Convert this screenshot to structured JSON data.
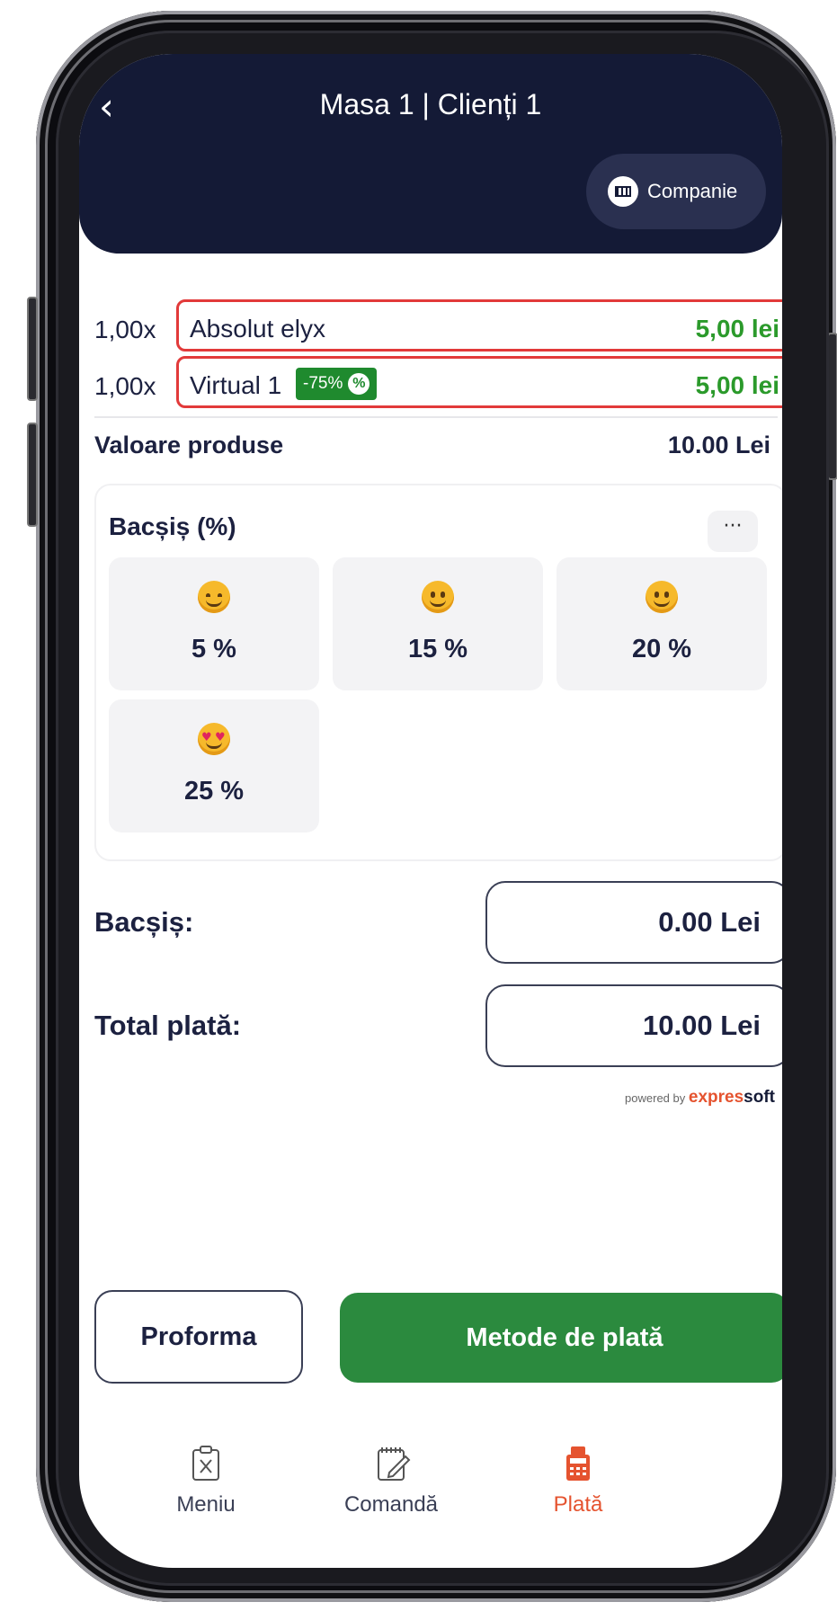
{
  "header": {
    "title": "Masa 1 | Clienți 1",
    "company_label": "Companie"
  },
  "products": [
    {
      "qty": "1,00x",
      "name": "Absolut elyx",
      "price": "5,00 lei"
    },
    {
      "qty": "1,00x",
      "name": "Virtual 1",
      "discount": "-75%",
      "price": "5,00 lei"
    }
  ],
  "summary": {
    "value_label": "Valoare produse",
    "value_amount": "10.00 Lei"
  },
  "tip": {
    "title": "Bacșiș (%)",
    "more": "···",
    "options": [
      {
        "label": "5 %",
        "emoji": "smiling-face-icon"
      },
      {
        "label": "15 %",
        "emoji": "grinning-face-icon"
      },
      {
        "label": "20 %",
        "emoji": "grinning-face-icon"
      },
      {
        "label": "25 %",
        "emoji": "heart-eyes-face-icon"
      }
    ]
  },
  "totals": {
    "tip_label": "Bacșiș:",
    "tip_value": "0.00 Lei",
    "total_label": "Total plată:",
    "total_value": "10.00 Lei"
  },
  "branding": {
    "powered_by": "powered by",
    "brand_a": "expres",
    "brand_b": "soft"
  },
  "actions": {
    "proforma": "Proforma",
    "pay_methods": "Metode de plată"
  },
  "nav": [
    {
      "label": "Meniu",
      "icon": "menu-clipboard-icon",
      "active": false
    },
    {
      "label": "Comandă",
      "icon": "order-notepad-icon",
      "active": false
    },
    {
      "label": "Plată",
      "icon": "payment-terminal-icon",
      "active": true
    }
  ],
  "colors": {
    "header_bg": "#141a36",
    "accent_green": "#2b8a3e",
    "price_green": "#2b9a2b",
    "highlight_red": "#e23a3a",
    "active_nav": "#e5532f"
  }
}
